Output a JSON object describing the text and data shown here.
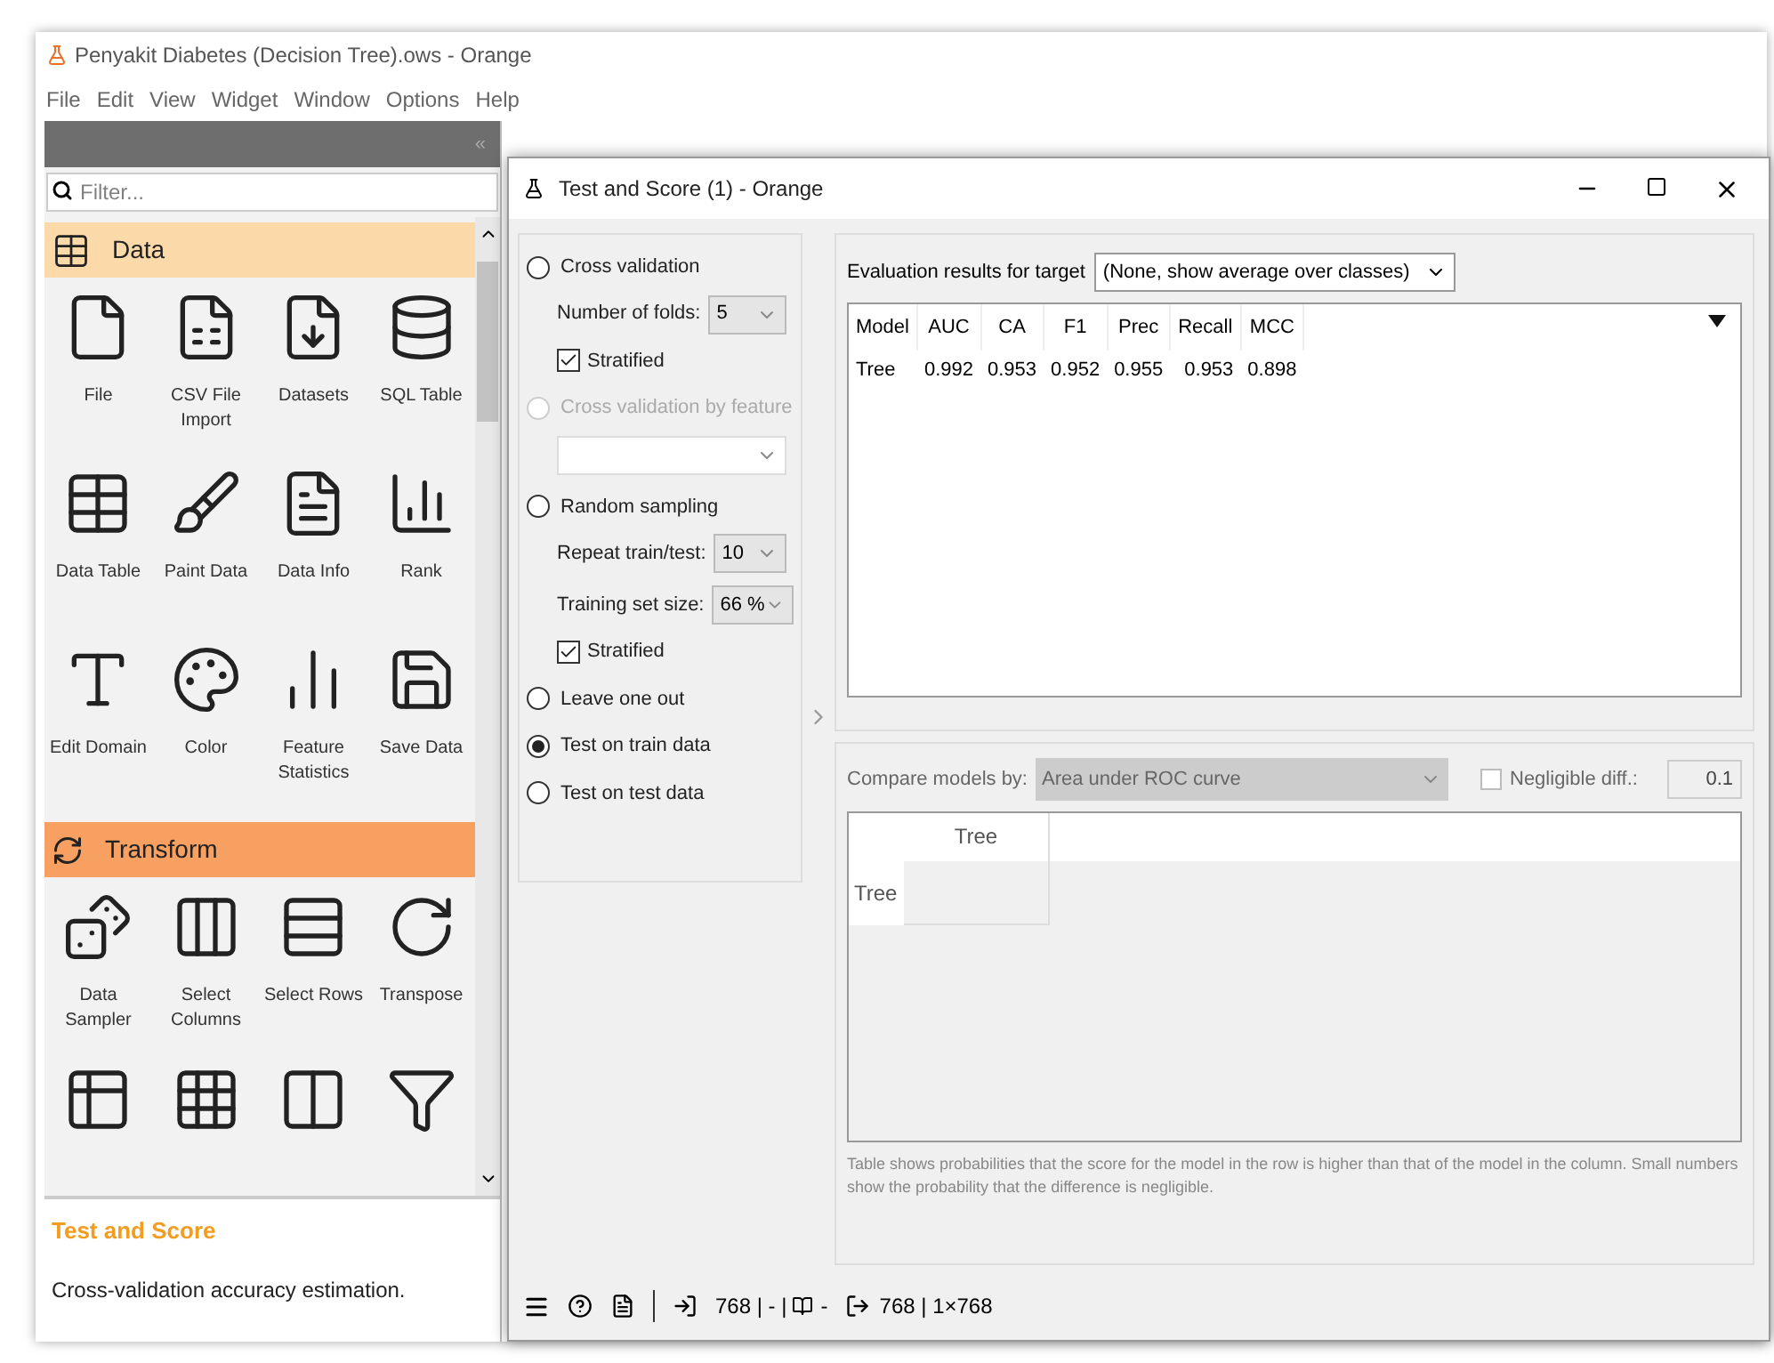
{
  "window": {
    "title": "Penyakit Diabetes (Decision Tree).ows - Orange"
  },
  "menu": [
    "File",
    "Edit",
    "View",
    "Widget",
    "Window",
    "Options",
    "Help"
  ],
  "dock": {
    "collapse": "«",
    "filter_placeholder": "Filter...",
    "categories": [
      {
        "name": "Data",
        "selected": false,
        "widgets": [
          "File",
          "CSV File Import",
          "Datasets",
          "SQL Table",
          "Data Table",
          "Paint Data",
          "Data Info",
          "Rank",
          "Edit Domain",
          "Color",
          "Feature Statistics",
          "Save Data"
        ]
      },
      {
        "name": "Transform",
        "selected": true,
        "widgets": [
          "Data Sampler",
          "Select Columns",
          "Select Rows",
          "Transpose"
        ]
      }
    ],
    "description": {
      "title": "Test and Score",
      "text": "Cross-validation accuracy estimation."
    }
  },
  "widget_window": {
    "title": "Test and Score (1) - Orange",
    "sampling": [
      {
        "kind": "radio",
        "label": "Cross validation",
        "selected": false,
        "disabled": false,
        "children": [
          {
            "kind": "select",
            "label": "Number of folds:",
            "value": "5"
          },
          {
            "kind": "checkbox",
            "label": "Stratified",
            "checked": true
          }
        ]
      },
      {
        "kind": "radio",
        "label": "Cross validation by feature",
        "selected": false,
        "disabled": true,
        "children": [
          {
            "kind": "select"
          }
        ]
      },
      {
        "kind": "radio",
        "label": "Random sampling",
        "selected": false,
        "disabled": false,
        "children": [
          {
            "kind": "select",
            "label": "Repeat train/test:",
            "value": "10"
          },
          {
            "kind": "select",
            "label": "Training set size:",
            "value": "66 %"
          },
          {
            "kind": "checkbox",
            "label": "Stratified",
            "checked": true
          }
        ]
      },
      {
        "kind": "radio",
        "label": "Leave one out",
        "selected": false,
        "disabled": false
      },
      {
        "kind": "radio",
        "label": "Test on train data",
        "selected": true,
        "disabled": false
      },
      {
        "kind": "radio",
        "label": "Test on test data",
        "selected": false,
        "disabled": false
      }
    ],
    "target": {
      "label": "Evaluation results for target",
      "value": "(None, show average over classes)"
    },
    "results": {
      "columns": [
        "Model",
        "AUC",
        "CA",
        "F1",
        "Prec",
        "Recall",
        "MCC"
      ],
      "rows": [
        [
          "Tree",
          "0.992",
          "0.953",
          "0.952",
          "0.955",
          "0.953",
          "0.898"
        ]
      ]
    },
    "compare": {
      "label": "Compare models by:",
      "value": "Area under ROC curve",
      "negligible": {
        "label": "Negligible diff.:",
        "checked": false,
        "value": "0.1"
      },
      "columns": [
        "Tree"
      ],
      "rows": [
        "Tree"
      ],
      "note": "Table shows probabilities that the score for the model in the row is higher than that of the model in the column. Small numbers show the probability that the difference is negligible."
    },
    "status": {
      "input": "768 | - |",
      "input_extra": "-",
      "output": "768 | 1×768"
    }
  }
}
